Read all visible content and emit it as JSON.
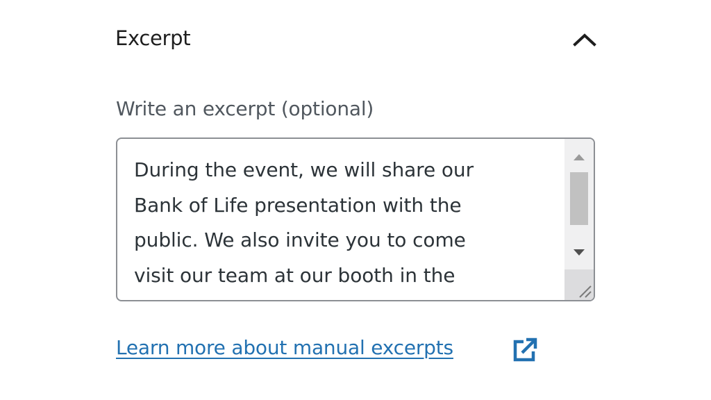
{
  "panel": {
    "title": "Excerpt",
    "toggle_icon": "chevron-up-icon"
  },
  "excerpt_field": {
    "label": "Write an excerpt (optional)",
    "value_lines": [
      "During the event, we will share our",
      "Bank of Life presentation with the",
      "public. We also invite you to come",
      "visit our team at our booth in the"
    ]
  },
  "help_link": {
    "label": "Learn more about manual excerpts",
    "icon": "external-link-icon"
  },
  "colors": {
    "link": "#2271b1",
    "text": "#1e1e1e",
    "label": "#50575e",
    "border": "#8c8f94"
  }
}
